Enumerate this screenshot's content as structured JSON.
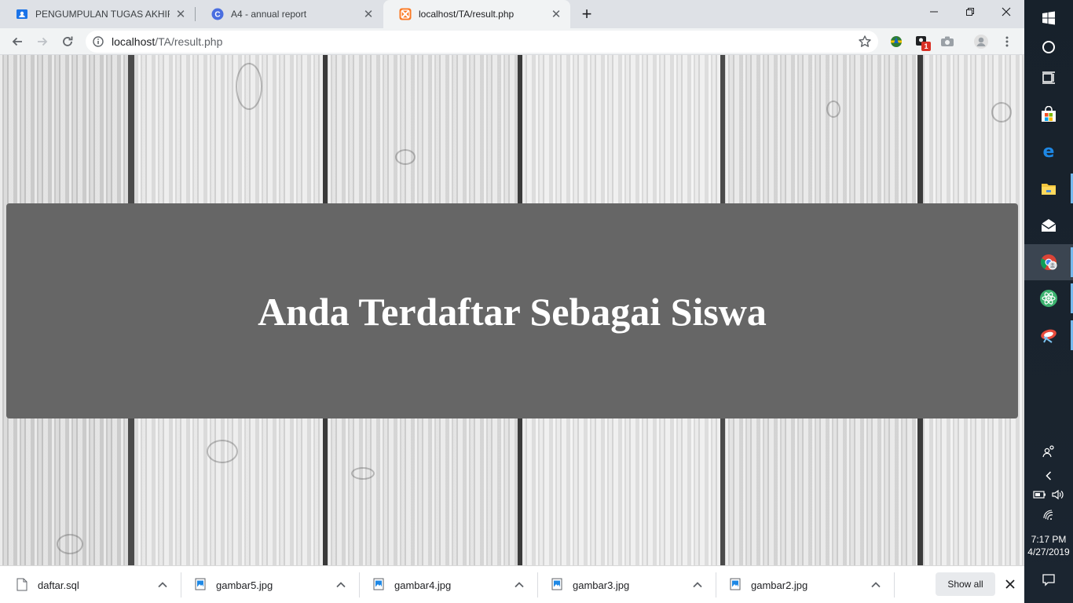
{
  "tabs": [
    {
      "title": "PENGUMPULAN TUGAS AKHIR WEB",
      "active": false
    },
    {
      "title": "A4 - annual report",
      "active": false
    },
    {
      "title": "localhost/TA/result.php",
      "active": true
    }
  ],
  "address_bar": {
    "url_host": "localhost",
    "url_path": "/TA/result.php"
  },
  "extension_badge": "1",
  "page": {
    "heading": "Anda Terdaftar Sebagai Siswa"
  },
  "downloads": [
    {
      "name": "daftar.sql",
      "type": "file"
    },
    {
      "name": "gambar5.jpg",
      "type": "image"
    },
    {
      "name": "gambar4.jpg",
      "type": "image"
    },
    {
      "name": "gambar3.jpg",
      "type": "image"
    },
    {
      "name": "gambar2.jpg",
      "type": "image"
    }
  ],
  "download_shelf": {
    "show_all_label": "Show all"
  },
  "taskbar": {
    "time": "7:17 PM",
    "date": "4/27/2019"
  },
  "colors": {
    "banner": "#666666",
    "page_wood": "#e0e0e0",
    "taskbar": "#1b2530"
  }
}
